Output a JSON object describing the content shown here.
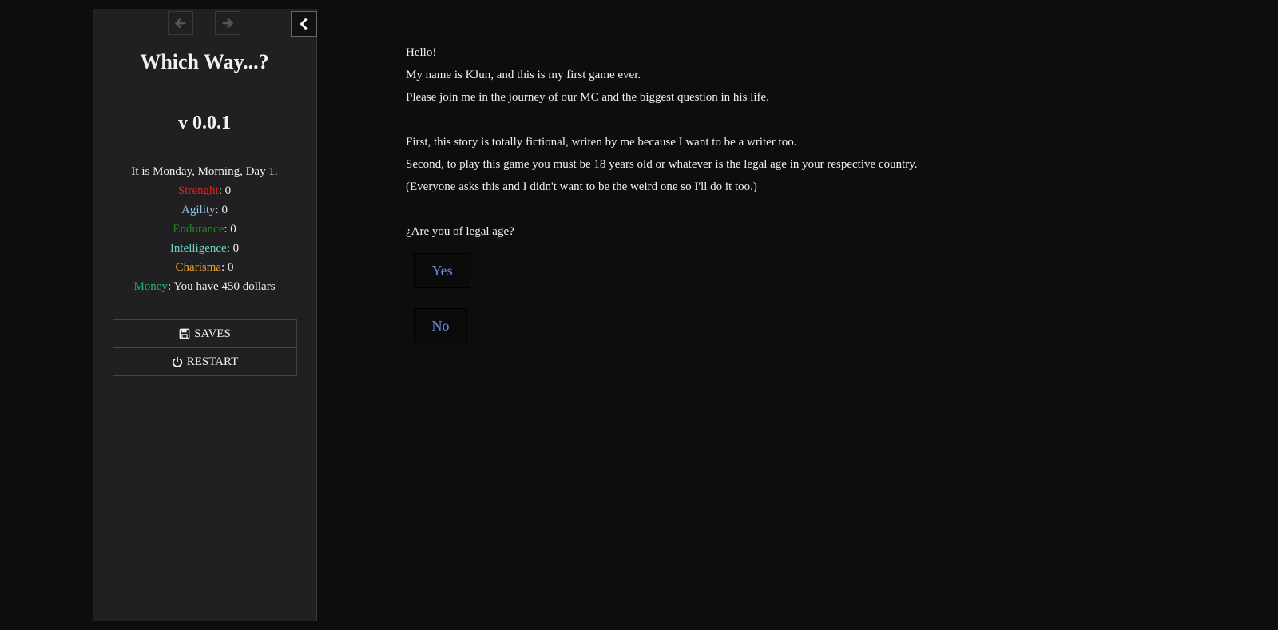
{
  "sidebar": {
    "title": "Which Way...?",
    "version": "v 0.0.1",
    "status_line": "It is Monday, Morning, Day 1.",
    "stats": [
      {
        "label": "Strenght",
        "value": ": 0",
        "color": "#e0221a"
      },
      {
        "label": "Agility",
        "value": ": 0",
        "color": "#8ec0e6"
      },
      {
        "label": "Endurance",
        "value": ": 0",
        "color": "#1e8a1e"
      },
      {
        "label": "Intelligence",
        "value": ": 0",
        "color": "#6fd6c6"
      },
      {
        "label": "Charisma",
        "value": ": 0",
        "color": "#f0a030"
      },
      {
        "label": "Money",
        "value": ": You have 450 dollars",
        "color": "#1fb36a"
      }
    ],
    "menu": {
      "saves_label": "SAVES",
      "restart_label": "RESTART"
    },
    "icons": {
      "back": "arrow-left-icon",
      "forward": "arrow-right-icon",
      "toggle": "chevron-left-icon",
      "saves": "floppy-disk-icon",
      "restart": "power-icon"
    }
  },
  "passage": {
    "lines": [
      "Hello!",
      "My name is KJun, and this is my first game ever.",
      "Please join me in the journey of our MC and the biggest question in his life.",
      "",
      "First, this story is totally fictional, writen by me because I want to be a writer too.",
      "Second, to play this game you must be 18 years old or whatever is the legal age in your respective country.",
      "(Everyone asks this and I didn't want to be the weird one so I'll do it too.)",
      "",
      "¿Are you of legal age?"
    ],
    "choices": [
      {
        "label": "Yes"
      },
      {
        "label": "No"
      }
    ]
  },
  "colors": {
    "background": "#0d0d0e",
    "sidebar": "#202023",
    "link": "#6e8fe6"
  }
}
